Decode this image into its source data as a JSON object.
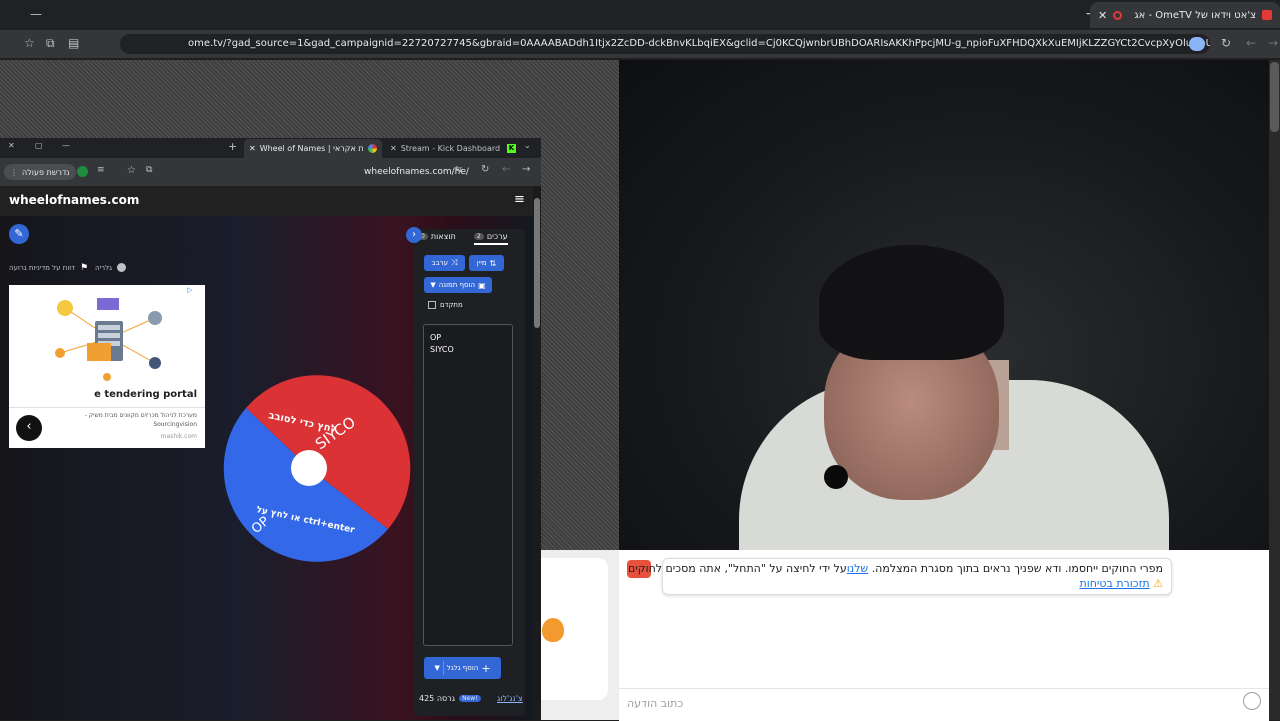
{
  "outer_browser": {
    "tab_title": "צ'אט וידאו של OmeTV - אג",
    "url": "ome.tv/?gad_source=1&gad_campaignid=22720727745&gbraid=0AAAABADdh1Itjx2ZcDD-dckBnvKLbqiEX&gclid=Cj0KCQjwnbrUBhDOARIsAKKhPpcjMU-g_npioFuXFHDQXkXuEMIjKLZZGYCt2CvcpXyOluNoUjZDT04aAkmVEALw_wcB"
  },
  "inner_browser": {
    "tabs": [
      {
        "label": "Wheel of Names | בוחר שמות אקראי"
      },
      {
        "label": "Stream - Kick Dashboard"
      }
    ],
    "url": "wheelofnames.com/he/",
    "action_required": "נדרשת פעולה"
  },
  "wheel_site": {
    "brand": "wheelofnames.com",
    "gallery_label": "גלריה",
    "report_label": "דווח על מדיניות גרועה",
    "tabs": [
      {
        "label": "ערכים",
        "count": "2"
      },
      {
        "label": "תוצאות",
        "count": "0"
      }
    ],
    "shuffle_label": "ערבב",
    "sort_label": "מיין",
    "add_image_label": "הוסף תמונה",
    "advanced_label": "מתקדם",
    "entries": [
      "OP",
      "SIYCO"
    ],
    "add_wheel_label": "הוסף גלגל",
    "version": "גרסה 425",
    "new_badge": "New!",
    "changelog": "צ'נג'לוג",
    "wheel_segments": [
      "לחץ כדי לסובב",
      "SIYCO",
      "או לחץ על ctrl+enter",
      "OP"
    ],
    "wheel_colors": {
      "red": "#db3236",
      "blue": "#3369e8"
    }
  },
  "ad": {
    "title": "e tendering portal",
    "description": "מערכת לניהול מכרזים מקוונים מבית משיק - Sourcingvision",
    "domain": "mashik.com"
  },
  "chat": {
    "notice_text": "מפרי החוקים ייחסמו. ודא שפניך נראים בתוך מסגרת המצלמה.",
    "notice_link": "שלנו",
    "notice_tail": "על ידי לחיצה על \"התחל\", אתה מסכים לחוקים",
    "safety_link": "תזכורת בטיחות",
    "input_placeholder": "כתוב הודעה"
  }
}
